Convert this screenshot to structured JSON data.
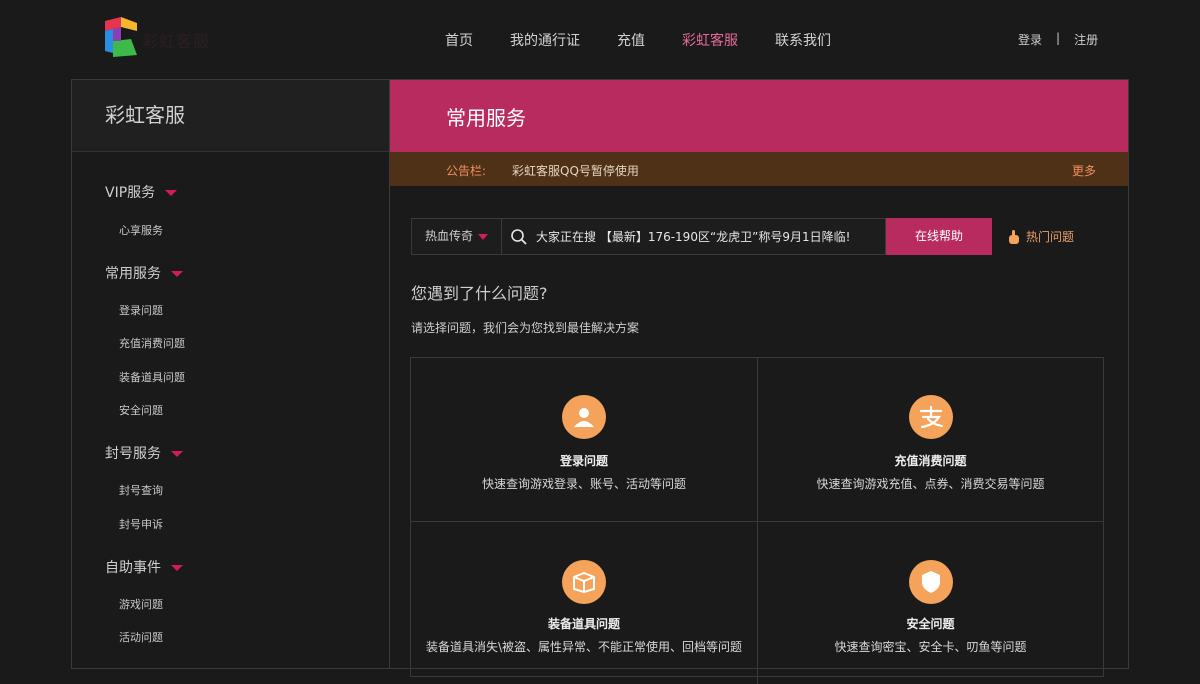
{
  "header": {
    "logo_text": "彩虹客服",
    "nav": [
      "首页",
      "我的通行证",
      "充值",
      "彩虹客服",
      "联系我们"
    ],
    "active_nav": "彩虹客服",
    "login": "登录",
    "separator": "|",
    "register": "注册"
  },
  "sidebar": {
    "title": "彩虹客服",
    "groups": [
      {
        "label": "VIP服务",
        "items": [
          "心享服务"
        ]
      },
      {
        "label": "常用服务",
        "items": [
          "登录问题",
          "充值消费问题",
          "装备道具问题",
          "安全问题"
        ]
      },
      {
        "label": "封号服务",
        "items": [
          "封号查询",
          "封号申诉"
        ]
      },
      {
        "label": "自助事件",
        "items": [
          "游戏问题",
          "活动问题"
        ]
      }
    ]
  },
  "main": {
    "title": "常用服务",
    "notice_label": "公告栏:",
    "notice_text": "彩虹客服QQ号暂停使用",
    "notice_more": "更多",
    "game_select": "热血传奇",
    "search_value": "大家正在搜 【最新】176-190区“龙虎卫”称号9月1日降临!",
    "help_button": "在线帮助",
    "hot_link": "热门问题",
    "question_title": "您遇到了什么问题?",
    "question_sub": "请选择问题，我们会为您找到最佳解决方案",
    "categories": [
      {
        "title": "登录问题",
        "desc": "快速查询游戏登录、账号、活动等问题",
        "icon": "user-icon"
      },
      {
        "title": "充值消费问题",
        "desc": "快速查询游戏充值、点券、消费交易等问题",
        "icon": "payment-icon"
      },
      {
        "title": "装备道具问题",
        "desc": "装备道具消失\\被盗、属性异常、不能正常使用、回档等问题",
        "icon": "box-icon"
      },
      {
        "title": "安全问题",
        "desc": "快速查询密宝、安全卡、叨鱼等问题",
        "icon": "shield-icon"
      }
    ]
  },
  "colors": {
    "accent": "#b82b5f",
    "notice_bg": "#4e3116",
    "icon_bg": "#f5a35a"
  }
}
